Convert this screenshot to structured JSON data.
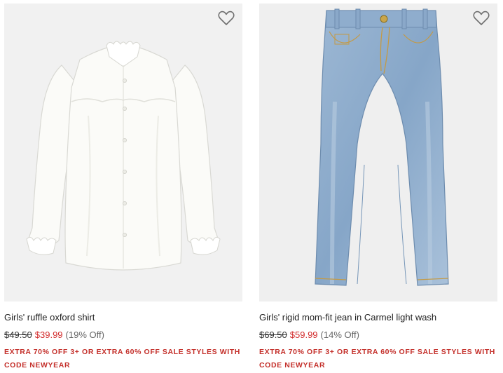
{
  "products": [
    {
      "title": "Girls' ruffle oxford shirt",
      "original_price": "$49.50",
      "sale_price": "$39.99",
      "discount": "(19% Off)",
      "promo": "EXTRA 70% OFF 3+ OR EXTRA 60% OFF SALE STYLES WITH CODE NEWYEAR",
      "image": "white ruffle oxford shirt",
      "wishlist_icon": "heart-outline-icon"
    },
    {
      "title": "Girls' rigid mom-fit jean in Carmel light wash",
      "original_price": "$69.50",
      "sale_price": "$59.99",
      "discount": "(14% Off)",
      "promo": "EXTRA 70% OFF 3+ OR EXTRA 60% OFF SALE STYLES WITH CODE NEWYEAR",
      "image": "light wash denim jeans",
      "wishlist_icon": "heart-outline-icon"
    }
  ],
  "colors": {
    "sale": "#d22b2b",
    "promo": "#c4302b",
    "image_bg": "#f1f1f1"
  }
}
